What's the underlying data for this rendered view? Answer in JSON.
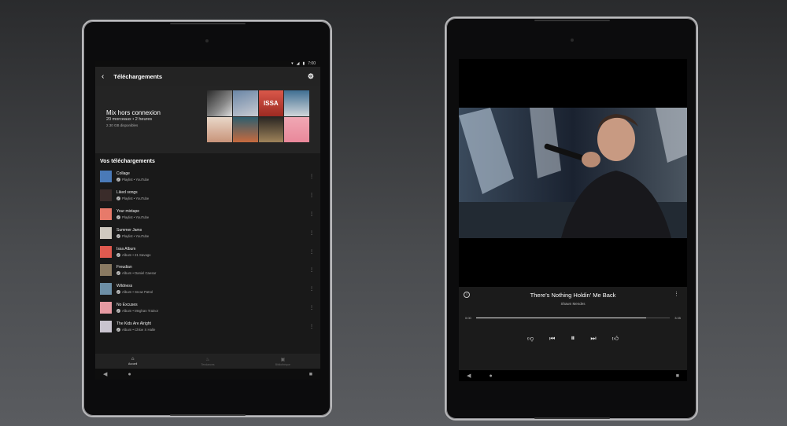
{
  "left_phone": {
    "status": {
      "time": "7:00",
      "wifi_icon": "wifi-icon",
      "signal_icon": "signal-icon",
      "battery_icon": "battery-icon"
    },
    "appbar": {
      "title": "Téléchargements"
    },
    "mix": {
      "title": "Mix hors connexion",
      "subtitle": "20 morceaux • 2 heures",
      "storage": "2.30 GB disponibles"
    },
    "section_title": "Vos téléchargements",
    "items": [
      {
        "name": "Collage",
        "sub": "Playlist • YouTube",
        "color": "#4a7ab8"
      },
      {
        "name": "Liked songs",
        "sub": "Playlist • YouTube",
        "color": "#3a2c2a"
      },
      {
        "name": "Your mixtape",
        "sub": "Playlist • YouTube",
        "color": "#e77a6a"
      },
      {
        "name": "Summer Jams",
        "sub": "Playlist • YouTube",
        "color": "#cfc9c0"
      },
      {
        "name": "Issa Album",
        "sub": "Album • 21 Savage",
        "color": "#e05a4f"
      },
      {
        "name": "Freudian",
        "sub": "Album • Daniel Caesar",
        "color": "#8a7a62"
      },
      {
        "name": "Wildness",
        "sub": "Album • Snow Patrol",
        "color": "#6d8fa6"
      },
      {
        "name": "No Excuses",
        "sub": "Album • Meghan Trainor",
        "color": "#e69aa2"
      },
      {
        "name": "The Kids Are Alright",
        "sub": "Album • Chloe X Halle",
        "color": "#c9c4cf"
      }
    ],
    "nav": [
      {
        "label": "Accueil",
        "icon": "home-icon",
        "glyph": "⌂"
      },
      {
        "label": "Tendances",
        "icon": "flame-icon",
        "glyph": "♨"
      },
      {
        "label": "Bibliothèque",
        "icon": "library-icon",
        "glyph": "▣"
      }
    ]
  },
  "right_phone": {
    "song": {
      "title": "There's Nothing Holdin' Me Back",
      "artist": "Shawn Mendes"
    },
    "time_current": "0:00",
    "time_total": "3:35",
    "progress": 0.88
  }
}
